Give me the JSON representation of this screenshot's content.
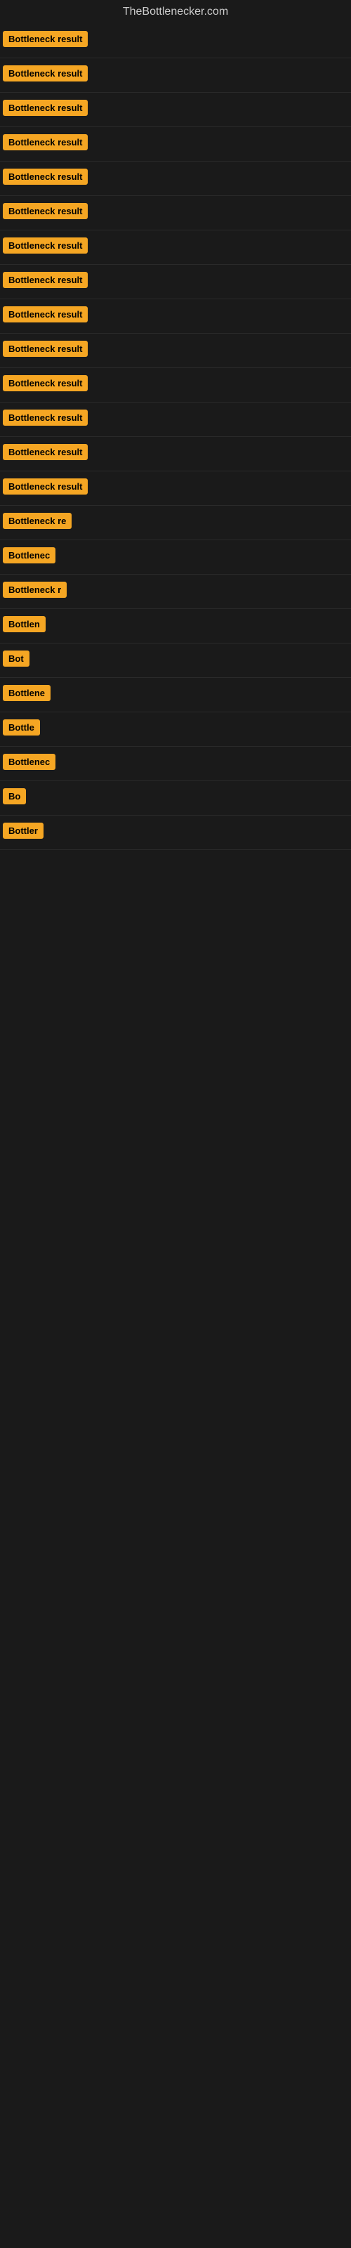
{
  "site": {
    "title": "TheBottlenecker.com"
  },
  "results": [
    {
      "id": 1,
      "label": "Bottleneck result",
      "visible_width": "full"
    },
    {
      "id": 2,
      "label": "Bottleneck result",
      "visible_width": "full"
    },
    {
      "id": 3,
      "label": "Bottleneck result",
      "visible_width": "full"
    },
    {
      "id": 4,
      "label": "Bottleneck result",
      "visible_width": "full"
    },
    {
      "id": 5,
      "label": "Bottleneck result",
      "visible_width": "full"
    },
    {
      "id": 6,
      "label": "Bottleneck result",
      "visible_width": "full"
    },
    {
      "id": 7,
      "label": "Bottleneck result",
      "visible_width": "full"
    },
    {
      "id": 8,
      "label": "Bottleneck result",
      "visible_width": "full"
    },
    {
      "id": 9,
      "label": "Bottleneck result",
      "visible_width": "full"
    },
    {
      "id": 10,
      "label": "Bottleneck result",
      "visible_width": "full"
    },
    {
      "id": 11,
      "label": "Bottleneck result",
      "visible_width": "full"
    },
    {
      "id": 12,
      "label": "Bottleneck result",
      "visible_width": "full"
    },
    {
      "id": 13,
      "label": "Bottleneck result",
      "visible_width": "full"
    },
    {
      "id": 14,
      "label": "Bottleneck result",
      "visible_width": "full"
    },
    {
      "id": 15,
      "label": "Bottleneck re",
      "visible_width": "partial-1"
    },
    {
      "id": 16,
      "label": "Bottlenec",
      "visible_width": "partial-2"
    },
    {
      "id": 17,
      "label": "Bottleneck r",
      "visible_width": "partial-3"
    },
    {
      "id": 18,
      "label": "Bottlen",
      "visible_width": "partial-4"
    },
    {
      "id": 19,
      "label": "Bot",
      "visible_width": "partial-5"
    },
    {
      "id": 20,
      "label": "Bottlene",
      "visible_width": "partial-6"
    },
    {
      "id": 21,
      "label": "Bottle",
      "visible_width": "partial-7"
    },
    {
      "id": 22,
      "label": "Bottlenec",
      "visible_width": "partial-8"
    },
    {
      "id": 23,
      "label": "Bo",
      "visible_width": "partial-9"
    },
    {
      "id": 24,
      "label": "Bottler",
      "visible_width": "partial-10"
    }
  ],
  "colors": {
    "badge_bg": "#f5a623",
    "badge_text": "#000000",
    "page_bg": "#1a1a1a",
    "title_color": "#cccccc"
  }
}
